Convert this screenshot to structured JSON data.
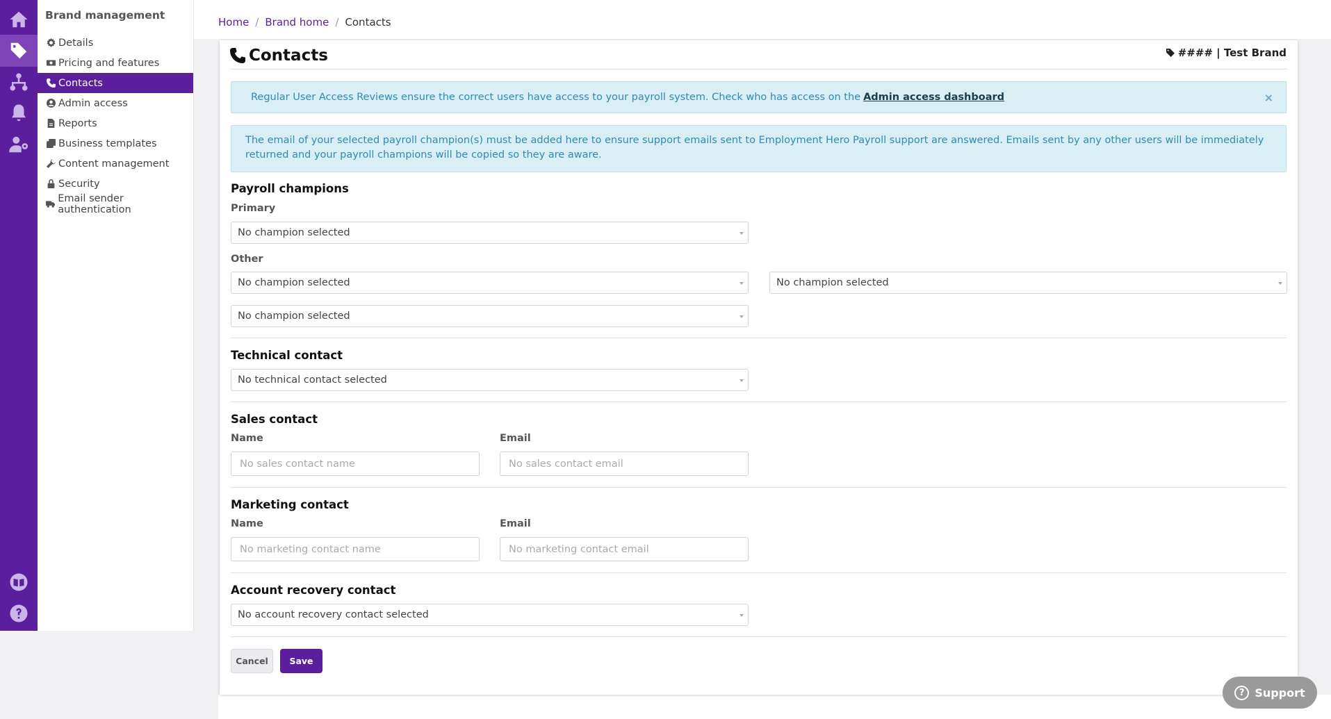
{
  "sidebar": {
    "title": "Brand management",
    "items": [
      {
        "label": "Details",
        "icon": "gear-icon"
      },
      {
        "label": "Pricing and features",
        "icon": "money-icon"
      },
      {
        "label": "Contacts",
        "icon": "phone-icon",
        "active": true
      },
      {
        "label": "Admin access",
        "icon": "user-circle-icon"
      },
      {
        "label": "Reports",
        "icon": "document-icon"
      },
      {
        "label": "Business templates",
        "icon": "copy-icon"
      },
      {
        "label": "Content management",
        "icon": "wrench-icon"
      },
      {
        "label": "Security",
        "icon": "lock-icon"
      },
      {
        "label": "Email sender authentication",
        "icon": "truck-icon"
      }
    ]
  },
  "rail": {
    "icons": [
      "home-icon",
      "tag-icon",
      "sitemap-icon",
      "bell-icon",
      "users-cog-icon",
      "book-icon",
      "help-icon"
    ]
  },
  "breadcrumb": {
    "home": "Home",
    "brand_home": "Brand home",
    "current": "Contacts"
  },
  "page": {
    "title": "Contacts",
    "brand_tag": "#### | Test Brand"
  },
  "alerts": {
    "access_review_text": "Regular User Access Reviews ensure the correct users have access to your payroll system. Check who has access on the",
    "access_review_link": "Admin access dashboard",
    "close_glyph": "×",
    "champion_info": "The email of your selected payroll champion(s) must be added here to ensure support emails sent to Employment Hero Payroll support are answered. Emails sent by any other users will be immediately returned and your payroll champions will be copied so they are aware."
  },
  "payroll_champions": {
    "title": "Payroll champions",
    "primary_label": "Primary",
    "primary_value": "No champion selected",
    "other_label": "Other",
    "other_values": [
      "No champion selected",
      "No champion selected",
      "No champion selected"
    ]
  },
  "technical_contact": {
    "title": "Technical contact",
    "value": "No technical contact selected"
  },
  "sales_contact": {
    "title": "Sales contact",
    "name_label": "Name",
    "name_placeholder": "No sales contact name",
    "email_label": "Email",
    "email_placeholder": "No sales contact email"
  },
  "marketing_contact": {
    "title": "Marketing contact",
    "name_label": "Name",
    "name_placeholder": "No marketing contact name",
    "email_label": "Email",
    "email_placeholder": "No marketing contact email"
  },
  "account_recovery": {
    "title": "Account recovery contact",
    "value": "No account recovery contact selected"
  },
  "actions": {
    "cancel": "Cancel",
    "save": "Save"
  },
  "support": {
    "label": "Support",
    "glyph": "?"
  },
  "colors": {
    "brand": "#5b1f9e",
    "alert_bg": "#d9eef5",
    "alert_text": "#2e8cb3"
  }
}
